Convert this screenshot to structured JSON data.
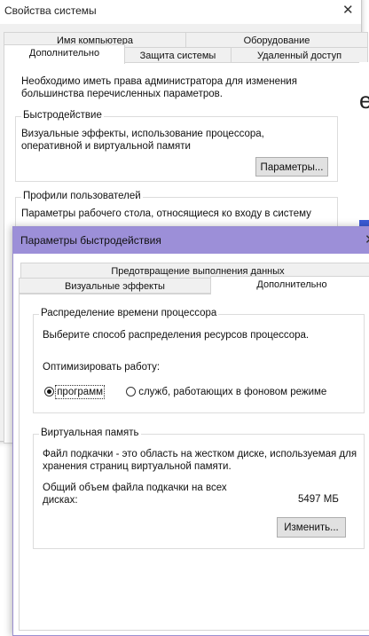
{
  "system_properties": {
    "title": "Свойства системы",
    "close_symbol": "✕",
    "tabs_row1": [
      "Имя компьютера",
      "Оборудование"
    ],
    "tabs_row2": [
      "Дополнительно",
      "Защита системы",
      "Удаленный доступ"
    ],
    "admin_note": "Необходимо иметь права администратора для изменения большинства перечисленных параметров.",
    "performance": {
      "heading": "Быстродействие",
      "description": "Визуальные эффекты, использование процессора, оперативной и виртуальной памяти",
      "button": "Параметры..."
    },
    "user_profiles": {
      "heading": "Профили пользователей",
      "description": "Параметры рабочего стола, относящиеся ко входу в систему"
    }
  },
  "peek_window": {
    "glyph": "e"
  },
  "performance_options": {
    "title": "Параметры быстродействия",
    "close_symbol": "✕",
    "tabs_top": [
      "Предотвращение выполнения данных"
    ],
    "tabs_bottom": [
      "Визуальные эффекты",
      "Дополнительно"
    ],
    "active_tab": "Дополнительно",
    "cpu": {
      "heading": "Распределение времени процессора",
      "instruction": "Выберите способ распределения ресурсов процессора.",
      "optimize_label": "Оптимизировать работу:",
      "options": [
        "программ",
        "служб, работающих в фоновом режиме"
      ],
      "selected": "программ"
    },
    "virtual_memory": {
      "heading": "Виртуальная память",
      "description": "Файл подкачки - это область на жестком диске, используемая для хранения страниц виртуальной памяти.",
      "total_label_line1": "Общий объем файла подкачки на всех",
      "total_label_line2": "дисках:",
      "total_value": "5497 МБ",
      "change_button": "Изменить..."
    }
  },
  "colors": {
    "dialog_titlebar": "#9c8fd8",
    "window_bg": "#f0f0f0",
    "accent_blue": "#3b5bd6"
  },
  "icons": {
    "close": "close-icon",
    "radio": "radio-icon"
  }
}
